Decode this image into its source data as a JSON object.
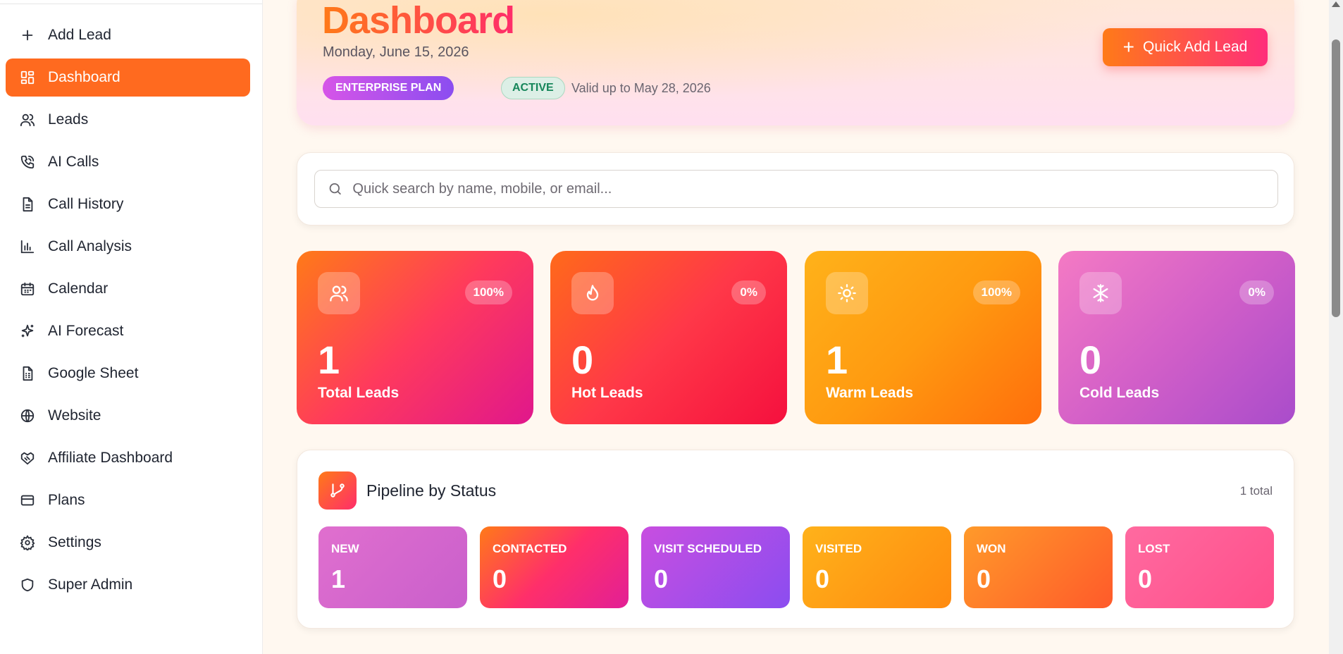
{
  "sidebar": {
    "items": [
      {
        "label": "Add Lead",
        "icon": "plus-icon",
        "active": false
      },
      {
        "label": "Dashboard",
        "icon": "dashboard-icon",
        "active": true
      },
      {
        "label": "Leads",
        "icon": "users-icon",
        "active": false
      },
      {
        "label": "AI Calls",
        "icon": "phone-call-icon",
        "active": false
      },
      {
        "label": "Call History",
        "icon": "document-icon",
        "active": false
      },
      {
        "label": "Call Analysis",
        "icon": "bar-chart-icon",
        "active": false
      },
      {
        "label": "Calendar",
        "icon": "calendar-icon",
        "active": false
      },
      {
        "label": "AI Forecast",
        "icon": "sparkles-icon",
        "active": false
      },
      {
        "label": "Google Sheet",
        "icon": "spreadsheet-icon",
        "active": false
      },
      {
        "label": "Website",
        "icon": "globe-icon",
        "active": false
      },
      {
        "label": "Affiliate Dashboard",
        "icon": "handshake-icon",
        "active": false
      },
      {
        "label": "Plans",
        "icon": "credit-card-icon",
        "active": false
      },
      {
        "label": "Settings",
        "icon": "gear-icon",
        "active": false
      },
      {
        "label": "Super Admin",
        "icon": "shield-icon",
        "active": false
      }
    ]
  },
  "header": {
    "title": "Dashboard",
    "date": "Monday, June 15, 2026",
    "plan_badge": "ENTERPRISE PLAN",
    "status_badge": "ACTIVE",
    "valid_text": "Valid up to May 28, 2026",
    "quick_add_label": "Quick Add Lead"
  },
  "search": {
    "placeholder": "Quick search by name, mobile, or email..."
  },
  "stats": [
    {
      "label": "Total Leads",
      "value": "1",
      "percent": "100%",
      "icon": "users-icon",
      "colors": [
        "#ff7a18",
        "#ff3a5c",
        "#e0178c"
      ]
    },
    {
      "label": "Hot Leads",
      "value": "0",
      "percent": "0%",
      "icon": "flame-icon",
      "colors": [
        "#ff6a1a",
        "#ff3848",
        "#f5103e"
      ]
    },
    {
      "label": "Warm Leads",
      "value": "1",
      "percent": "100%",
      "icon": "sun-icon",
      "colors": [
        "#ffb21a",
        "#ff9a10",
        "#ff6e0c"
      ]
    },
    {
      "label": "Cold Leads",
      "value": "0",
      "percent": "0%",
      "icon": "snowflake-icon",
      "colors": [
        "#f47ac4",
        "#d25fc8",
        "#a94ccb"
      ]
    }
  ],
  "pipeline": {
    "title": "Pipeline by Status",
    "total": "1 total",
    "statuses": [
      {
        "label": "NEW",
        "value": "1",
        "colors": [
          "#e06fce",
          "#c95fcc"
        ]
      },
      {
        "label": "CONTACTED",
        "value": "0",
        "colors": [
          "#ff7a18",
          "#ff2f6a",
          "#e21f96"
        ]
      },
      {
        "label": "VISIT SCHEDULED",
        "value": "0",
        "colors": [
          "#c84ee0",
          "#8b4df0"
        ]
      },
      {
        "label": "VISITED",
        "value": "0",
        "colors": [
          "#ffb21a",
          "#ff8a10"
        ]
      },
      {
        "label": "WON",
        "value": "0",
        "colors": [
          "#ff9a2a",
          "#ff5a2a"
        ]
      },
      {
        "label": "LOST",
        "value": "0",
        "colors": [
          "#ff6aa0",
          "#ff4f8a"
        ]
      }
    ]
  },
  "colors": {
    "accent": "#ff6a1f",
    "background": "#fff8f0"
  }
}
